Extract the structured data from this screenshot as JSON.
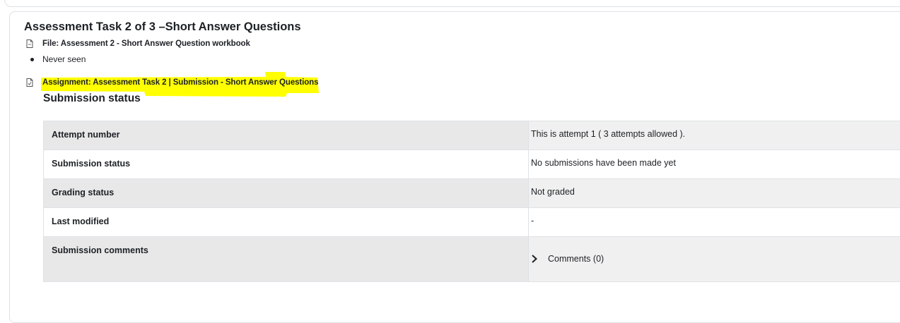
{
  "section": {
    "title": "Assessment Task 2 of 3 –Short Answer Questions"
  },
  "file_activity": {
    "label": "File: Assessment 2 - Short Answer Question workbook",
    "icon": "file-icon"
  },
  "completion": {
    "items": [
      "Never seen"
    ]
  },
  "assignment_activity": {
    "label": "Assignment: Assessment Task 2 | Submission - Short Answer Questions",
    "icon": "assignment-icon",
    "highlight_color": "#ffff00"
  },
  "submission_status": {
    "heading": "Submission status",
    "rows": [
      {
        "label": "Attempt number",
        "value": "This is attempt 1 ( 3 attempts allowed )."
      },
      {
        "label": "Submission status",
        "value": "No submissions have been made yet"
      },
      {
        "label": "Grading status",
        "value": "Not graded"
      },
      {
        "label": "Last modified",
        "value": "-"
      },
      {
        "label": "Submission comments",
        "value": ""
      }
    ],
    "comments_toggle": "Comments (0)"
  },
  "colors": {
    "text": "#1d2125",
    "border": "#dee2e6",
    "row_shade_label": "#e8e8e8",
    "row_shade_value": "#f0f0f0",
    "highlight": "#ffff00"
  }
}
